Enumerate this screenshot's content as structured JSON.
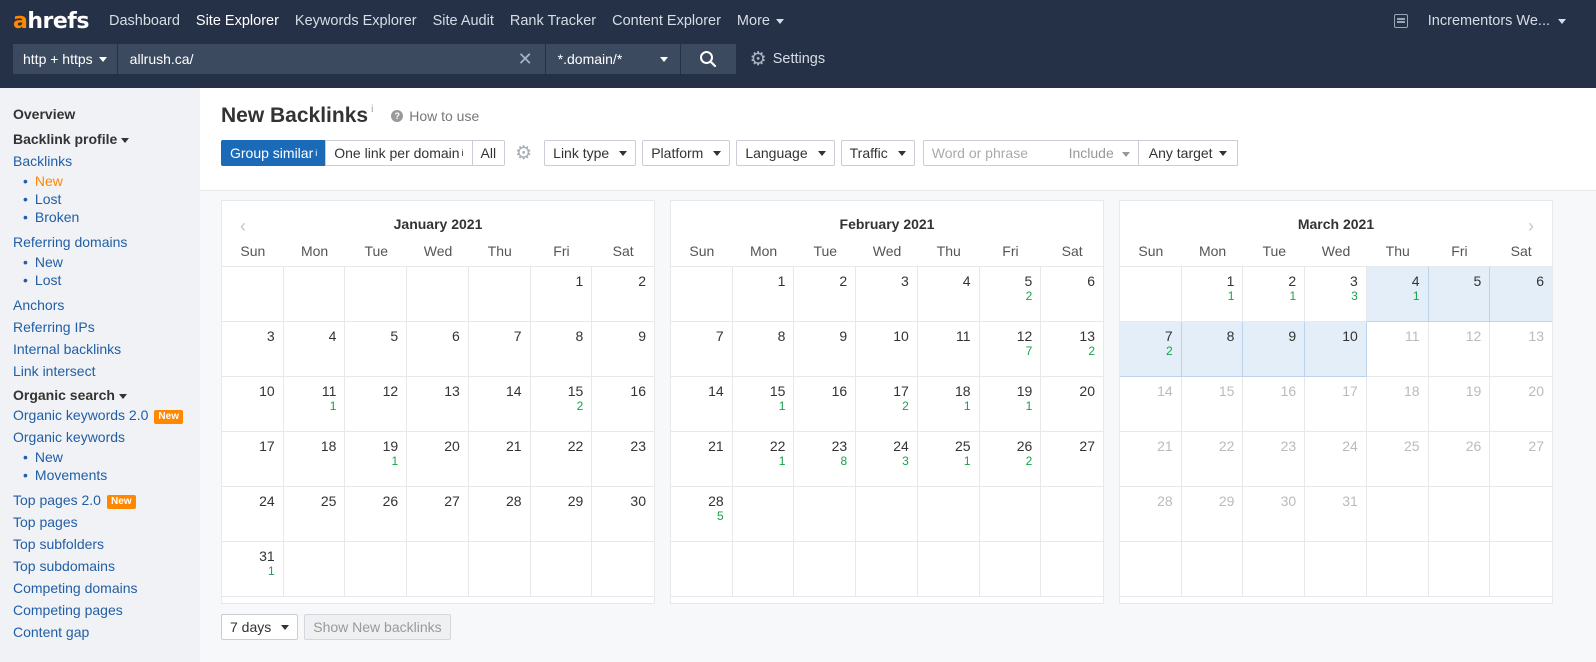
{
  "topnav": {
    "logo_a": "a",
    "logo_rest": "hrefs",
    "items": [
      {
        "label": "Dashboard",
        "active": false
      },
      {
        "label": "Site Explorer",
        "active": true
      },
      {
        "label": "Keywords Explorer",
        "active": false
      },
      {
        "label": "Site Audit",
        "active": false
      },
      {
        "label": "Rank Tracker",
        "active": false
      },
      {
        "label": "Content Explorer",
        "active": false
      }
    ],
    "more": "More",
    "account": "Incrementors We..."
  },
  "searchbar": {
    "protocol": "http + https",
    "url": "allrush.ca/",
    "mode": "*.domain/*",
    "settings": "Settings"
  },
  "sidebar": {
    "overview": "Overview",
    "backlink_profile": "Backlink profile",
    "backlinks": "Backlinks",
    "backlinks_sub": [
      {
        "label": "New",
        "active": true
      },
      {
        "label": "Lost",
        "active": false
      },
      {
        "label": "Broken",
        "active": false
      }
    ],
    "referring_domains": "Referring domains",
    "referring_domains_sub": [
      {
        "label": "New"
      },
      {
        "label": "Lost"
      }
    ],
    "anchors": "Anchors",
    "referring_ips": "Referring IPs",
    "internal_backlinks": "Internal backlinks",
    "link_intersect": "Link intersect",
    "organic_search": "Organic search",
    "organic_keywords_2": "Organic keywords 2.0",
    "new_badge": "New",
    "organic_keywords": "Organic keywords",
    "organic_keywords_sub": [
      {
        "label": "New"
      },
      {
        "label": "Movements"
      }
    ],
    "top_pages_2": "Top pages 2.0",
    "top_pages": "Top pages",
    "top_subfolders": "Top subfolders",
    "top_subdomains": "Top subdomains",
    "competing_domains": "Competing domains",
    "competing_pages": "Competing pages",
    "content_gap": "Content gap"
  },
  "main": {
    "title": "New Backlinks",
    "title_info": "i",
    "how_to_use": "How to use",
    "filters": {
      "group_similar": "Group similar",
      "one_link": "One link per domain",
      "all": "All",
      "info": "i",
      "link_type": "Link type",
      "platform": "Platform",
      "language": "Language",
      "traffic": "Traffic",
      "word_placeholder": "Word or phrase",
      "include": "Include",
      "any_target": "Any target"
    },
    "weekdays": [
      "Sun",
      "Mon",
      "Tue",
      "Wed",
      "Thu",
      "Fri",
      "Sat"
    ],
    "calendars": [
      {
        "title": "January 2021",
        "cells": [
          {
            "d": ""
          },
          {
            "d": ""
          },
          {
            "d": ""
          },
          {
            "d": ""
          },
          {
            "d": ""
          },
          {
            "d": "1"
          },
          {
            "d": "2"
          },
          {
            "d": "3"
          },
          {
            "d": "4"
          },
          {
            "d": "5"
          },
          {
            "d": "6"
          },
          {
            "d": "7"
          },
          {
            "d": "8"
          },
          {
            "d": "9"
          },
          {
            "d": "10"
          },
          {
            "d": "11",
            "c": "1"
          },
          {
            "d": "12"
          },
          {
            "d": "13"
          },
          {
            "d": "14"
          },
          {
            "d": "15",
            "c": "2"
          },
          {
            "d": "16"
          },
          {
            "d": "17"
          },
          {
            "d": "18"
          },
          {
            "d": "19",
            "c": "1"
          },
          {
            "d": "20"
          },
          {
            "d": "21"
          },
          {
            "d": "22"
          },
          {
            "d": "23"
          },
          {
            "d": "24"
          },
          {
            "d": "25"
          },
          {
            "d": "26"
          },
          {
            "d": "27"
          },
          {
            "d": "28"
          },
          {
            "d": "29"
          },
          {
            "d": "30"
          },
          {
            "d": "31",
            "c": "1"
          },
          {
            "d": ""
          },
          {
            "d": ""
          },
          {
            "d": ""
          },
          {
            "d": ""
          },
          {
            "d": ""
          },
          {
            "d": ""
          }
        ]
      },
      {
        "title": "February 2021",
        "cells": [
          {
            "d": ""
          },
          {
            "d": "1"
          },
          {
            "d": "2"
          },
          {
            "d": "3"
          },
          {
            "d": "4"
          },
          {
            "d": "5",
            "c": "2"
          },
          {
            "d": "6"
          },
          {
            "d": "7"
          },
          {
            "d": "8"
          },
          {
            "d": "9"
          },
          {
            "d": "10"
          },
          {
            "d": "11"
          },
          {
            "d": "12",
            "c": "7"
          },
          {
            "d": "13",
            "c": "2"
          },
          {
            "d": "14"
          },
          {
            "d": "15",
            "c": "1"
          },
          {
            "d": "16"
          },
          {
            "d": "17",
            "c": "2"
          },
          {
            "d": "18",
            "c": "1"
          },
          {
            "d": "19",
            "c": "1"
          },
          {
            "d": "20"
          },
          {
            "d": "21"
          },
          {
            "d": "22",
            "c": "1"
          },
          {
            "d": "23",
            "c": "8"
          },
          {
            "d": "24",
            "c": "3"
          },
          {
            "d": "25",
            "c": "1"
          },
          {
            "d": "26",
            "c": "2"
          },
          {
            "d": "27"
          },
          {
            "d": "28",
            "c": "5"
          },
          {
            "d": ""
          },
          {
            "d": ""
          },
          {
            "d": ""
          },
          {
            "d": ""
          },
          {
            "d": ""
          },
          {
            "d": ""
          },
          {
            "d": ""
          },
          {
            "d": ""
          },
          {
            "d": ""
          },
          {
            "d": ""
          },
          {
            "d": ""
          },
          {
            "d": ""
          },
          {
            "d": ""
          }
        ]
      },
      {
        "title": "March 2021",
        "cells": [
          {
            "d": ""
          },
          {
            "d": "1",
            "c": "1"
          },
          {
            "d": "2",
            "c": "1"
          },
          {
            "d": "3",
            "c": "3"
          },
          {
            "d": "4",
            "c": "1",
            "sel": true
          },
          {
            "d": "5",
            "sel": true
          },
          {
            "d": "6",
            "sel": true
          },
          {
            "d": "7",
            "c": "2",
            "sel": true
          },
          {
            "d": "8",
            "sel": true
          },
          {
            "d": "9",
            "sel": true
          },
          {
            "d": "10",
            "sel": true
          },
          {
            "d": "11",
            "f": true
          },
          {
            "d": "12",
            "f": true
          },
          {
            "d": "13",
            "f": true
          },
          {
            "d": "14",
            "f": true
          },
          {
            "d": "15",
            "f": true
          },
          {
            "d": "16",
            "f": true
          },
          {
            "d": "17",
            "f": true
          },
          {
            "d": "18",
            "f": true
          },
          {
            "d": "19",
            "f": true
          },
          {
            "d": "20",
            "f": true
          },
          {
            "d": "21",
            "f": true
          },
          {
            "d": "22",
            "f": true
          },
          {
            "d": "23",
            "f": true
          },
          {
            "d": "24",
            "f": true
          },
          {
            "d": "25",
            "f": true
          },
          {
            "d": "26",
            "f": true
          },
          {
            "d": "27",
            "f": true
          },
          {
            "d": "28",
            "f": true
          },
          {
            "d": "29",
            "f": true
          },
          {
            "d": "30",
            "f": true
          },
          {
            "d": "31",
            "f": true
          },
          {
            "d": ""
          },
          {
            "d": ""
          },
          {
            "d": ""
          },
          {
            "d": ""
          },
          {
            "d": ""
          },
          {
            "d": ""
          },
          {
            "d": ""
          },
          {
            "d": ""
          },
          {
            "d": ""
          },
          {
            "d": ""
          }
        ]
      }
    ],
    "period": "7 days",
    "show_button": "Show New backlinks"
  },
  "colors": {
    "nav_bg": "#253147",
    "accent_blue": "#1a6ab7",
    "link": "#225ea6",
    "active_orange": "#ff8800",
    "count_green": "#17a24b",
    "selected_bg": "#e3eef8"
  },
  "icons": [
    "notifications-icon",
    "clear-icon",
    "search-icon",
    "gear-icon",
    "help-icon",
    "chevron-left-icon",
    "chevron-right-icon"
  ]
}
